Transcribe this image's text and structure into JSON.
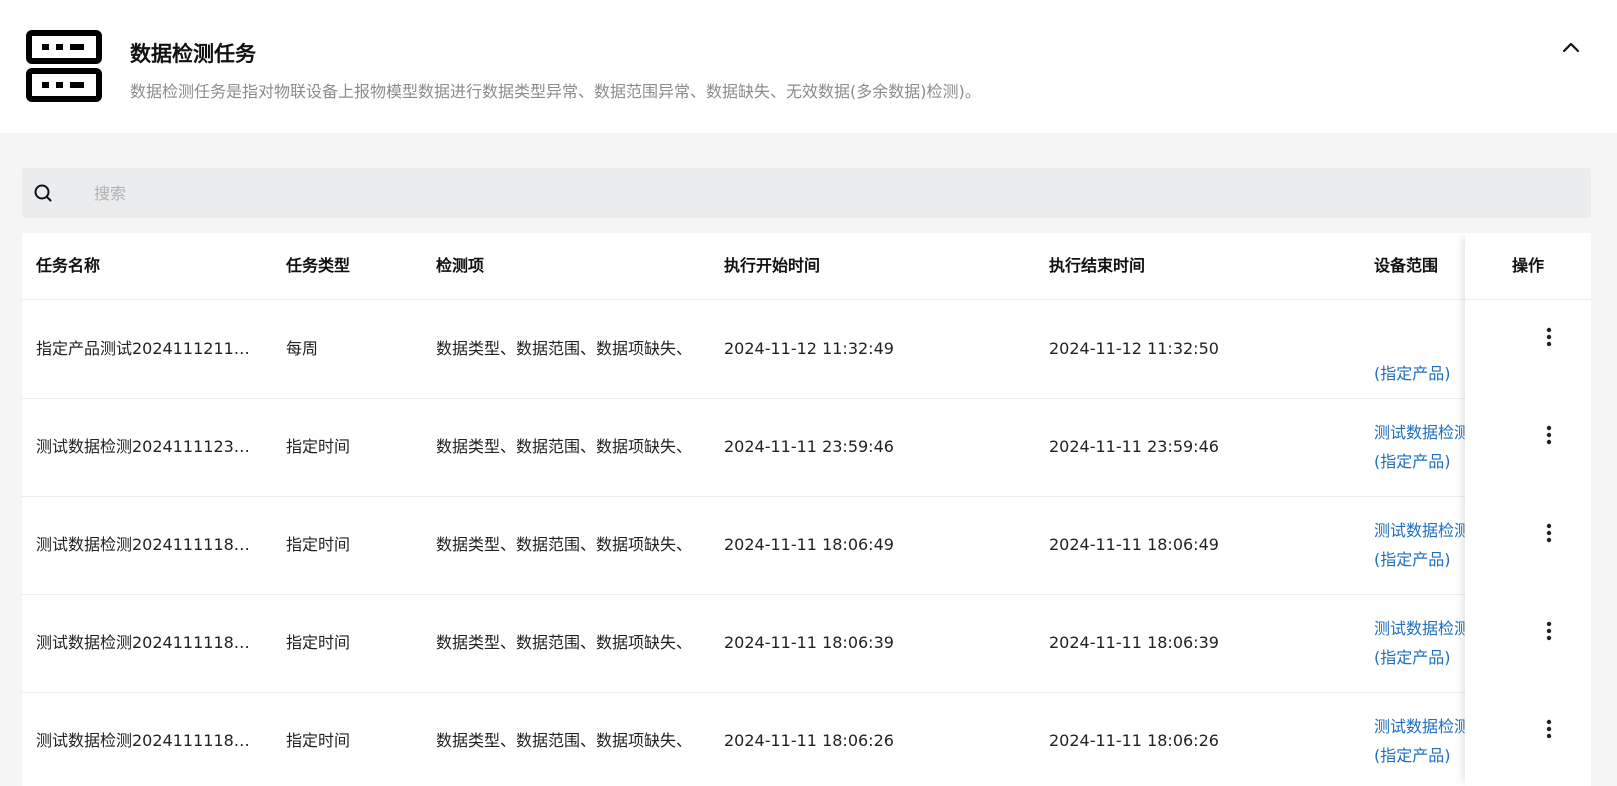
{
  "header": {
    "title": "数据检测任务",
    "description": "数据检测任务是指对物联设备上报物模型数据进行数据类型异常、数据范围异常、数据缺失、无效数据(多余数据)检测)。",
    "icon": "server-rack-icon",
    "collapse_icon": "chevron-up-icon"
  },
  "search": {
    "placeholder": "搜索",
    "value": "",
    "icon": "search-icon"
  },
  "table": {
    "columns": [
      "任务名称",
      "任务类型",
      "检测项",
      "执行开始时间",
      "执行结束时间",
      "设备范围",
      "操作"
    ],
    "rows": [
      {
        "name": "指定产品测试2024111211…",
        "type": "每周",
        "items": "数据类型、数据范围、数据项缺失、",
        "start": "2024-11-12 11:32:49",
        "end": "2024-11-12 11:32:50",
        "scope_line1": "",
        "scope_line2": "(指定产品)"
      },
      {
        "name": "测试数据检测2024111123…",
        "type": "指定时间",
        "items": "数据类型、数据范围、数据项缺失、",
        "start": "2024-11-11 23:59:46",
        "end": "2024-11-11 23:59:46",
        "scope_line1": "测试数据检测",
        "scope_line2": "(指定产品)"
      },
      {
        "name": "测试数据检测2024111118…",
        "type": "指定时间",
        "items": "数据类型、数据范围、数据项缺失、",
        "start": "2024-11-11 18:06:49",
        "end": "2024-11-11 18:06:49",
        "scope_line1": "测试数据检测",
        "scope_line2": "(指定产品)"
      },
      {
        "name": "测试数据检测2024111118…",
        "type": "指定时间",
        "items": "数据类型、数据范围、数据项缺失、",
        "start": "2024-11-11 18:06:39",
        "end": "2024-11-11 18:06:39",
        "scope_line1": "测试数据检测",
        "scope_line2": "(指定产品)"
      },
      {
        "name": "测试数据检测2024111118…",
        "type": "指定时间",
        "items": "数据类型、数据范围、数据项缺失、",
        "start": "2024-11-11 18:06:26",
        "end": "2024-11-11 18:06:26",
        "scope_line1": "测试数据检测",
        "scope_line2": "(指定产品)"
      }
    ],
    "row_action_icon": "more-vertical-icon"
  },
  "colors": {
    "link": "#1f6fbf",
    "page_bg": "#f5f5f6",
    "search_bg": "#ebecee"
  }
}
